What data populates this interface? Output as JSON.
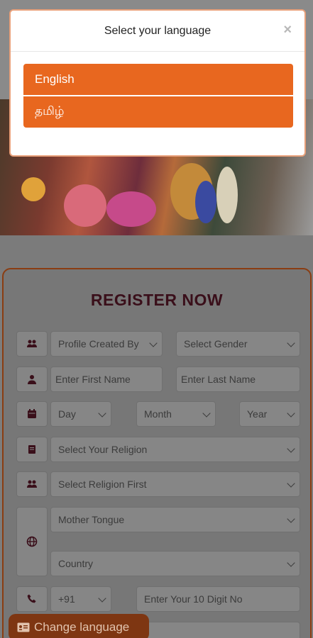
{
  "modal": {
    "title": "Select your language",
    "close": "×",
    "options": [
      "English",
      "தமிழ்"
    ]
  },
  "form": {
    "title": "REGISTER NOW",
    "profile_created_by": "Profile Created By",
    "gender": "Select Gender",
    "first_name_placeholder": "Enter First Name",
    "last_name_placeholder": "Enter Last Name",
    "day": "Day",
    "month": "Month",
    "year": "Year",
    "religion": "Select Your Religion",
    "caste": "Select Religion First",
    "mother_tongue": "Mother Tongue",
    "country": "Country",
    "country_code": "+91",
    "phone_placeholder": "Enter Your 10 Digit No"
  },
  "change_language": "Change language",
  "colors": {
    "accent": "#e8671f",
    "title": "#3a0f1a"
  }
}
